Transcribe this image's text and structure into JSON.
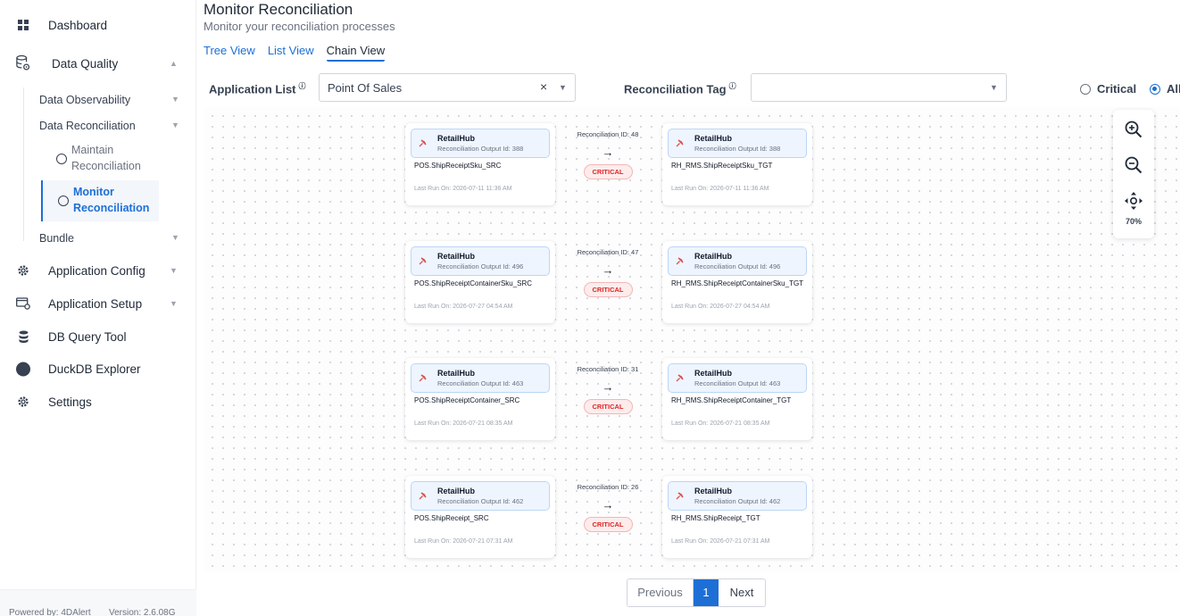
{
  "sidebar": {
    "items": [
      {
        "label": "Dashboard",
        "icon": "grid-icon"
      },
      {
        "label": "Data Quality",
        "icon": "database-gear-icon"
      },
      {
        "label": "Application Config",
        "icon": "gear-icon"
      },
      {
        "label": "Application Setup",
        "icon": "window-gear-icon"
      },
      {
        "label": "DB Query Tool",
        "icon": "database-icon"
      },
      {
        "label": "DuckDB Explorer",
        "icon": "duck-circle-icon"
      },
      {
        "label": "Settings",
        "icon": "gear-icon"
      }
    ],
    "sub": {
      "data_observability": "Data Observability",
      "data_reconciliation": "Data Reconciliation",
      "maintain": "Maintain Reconciliation",
      "monitor": "Monitor Reconciliation",
      "bundle": "Bundle"
    },
    "footer": {
      "powered": "Powered by: 4DAlert",
      "version": "Version: 2.6.08G"
    }
  },
  "header": {
    "title": "Monitor Reconciliation",
    "subtitle": "Monitor your reconciliation processes"
  },
  "tabs": [
    {
      "label": "Tree View"
    },
    {
      "label": "List View"
    },
    {
      "label": "Chain View",
      "active": true
    }
  ],
  "filters": {
    "application_label": "Application List",
    "application_value": "Point Of Sales",
    "tag_label": "Reconciliation Tag",
    "tag_value": "",
    "info_symbol": "ⓘ",
    "radio_critical": "Critical",
    "radio_all": "All",
    "selected": "All"
  },
  "chains": [
    {
      "recon_id": "Reconciliation ID: 48",
      "badge": "CRITICAL",
      "source": {
        "app": "RetailHub",
        "output": "Reconciliation Output Id: 388",
        "table": "POS.ShipReceiptSku_SRC",
        "run": "Last Run On: 2026-07-11 11:36 AM"
      },
      "target": {
        "app": "RetailHub",
        "output": "Reconciliation Output Id: 388",
        "table": "RH_RMS.ShipReceiptSku_TGT",
        "run": "Last Run On: 2026-07-11 11:36 AM"
      }
    },
    {
      "recon_id": "Reconciliation ID: 47",
      "badge": "CRITICAL",
      "source": {
        "app": "RetailHub",
        "output": "Reconciliation Output Id: 496",
        "table": "POS.ShipReceiptContainerSku_SRC",
        "run": "Last Run On: 2026-07-27 04:54 AM"
      },
      "target": {
        "app": "RetailHub",
        "output": "Reconciliation Output Id: 496",
        "table": "RH_RMS.ShipReceiptContainerSku_TGT",
        "run": "Last Run On: 2026-07-27 04:54 AM"
      }
    },
    {
      "recon_id": "Reconciliation ID: 31",
      "badge": "CRITICAL",
      "source": {
        "app": "RetailHub",
        "output": "Reconciliation Output Id: 463",
        "table": "POS.ShipReceiptContainer_SRC",
        "run": "Last Run On: 2026-07-21 08:35 AM"
      },
      "target": {
        "app": "RetailHub",
        "output": "Reconciliation Output Id: 463",
        "table": "RH_RMS.ShipReceiptContainer_TGT",
        "run": "Last Run On: 2026-07-21 08:35 AM"
      }
    },
    {
      "recon_id": "Reconciliation ID: 26",
      "badge": "CRITICAL",
      "source": {
        "app": "RetailHub",
        "output": "Reconciliation Output Id: 462",
        "table": "POS.ShipReceipt_SRC",
        "run": "Last Run On: 2026-07-21 07:31 AM"
      },
      "target": {
        "app": "RetailHub",
        "output": "Reconciliation Output Id: 462",
        "table": "RH_RMS.ShipReceipt_TGT",
        "run": "Last Run On: 2026-07-21 07:31 AM"
      }
    }
  ],
  "zoom": {
    "level": "70%"
  },
  "pagination": {
    "prev": "Previous",
    "page": "1",
    "next": "Next"
  },
  "colors": {
    "accent": "#1d6fd6",
    "critical": "#dc2626"
  }
}
